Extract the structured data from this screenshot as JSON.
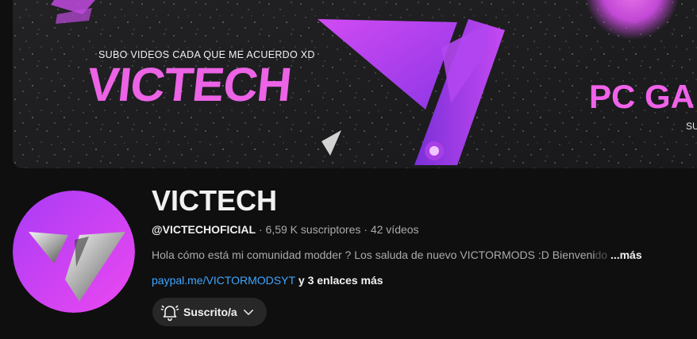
{
  "banner": {
    "tagline": "SUBO VIDEOS CADA QUE ME ACUERDO XD",
    "logo_text": "VICTECH",
    "right_text": "PC GA",
    "right_subtext": "SU"
  },
  "channel": {
    "name": "VICTECH",
    "handle": "@VICTECHOFICIAL",
    "separator": " · ",
    "subscribers": "6,59 K suscriptores",
    "videos": "42 vídeos",
    "description": "Hola cómo está mi comunidad modder ? Los saluda de nuevo VICTORMODS :D Bienveni",
    "description_fade": "do",
    "description_more": "...más",
    "link": "paypal.me/VICTORMODSYT",
    "more_links": " y 3 enlaces más"
  },
  "subscribe_button": {
    "label": "Suscrito/a",
    "bell_icon": "bell-icon",
    "chevron_icon": "chevron-down-icon"
  },
  "colors": {
    "background": "#0f0f0f",
    "accent_pink": "#ec63e6",
    "link_blue": "#3ea6ff",
    "button_bg": "#272727"
  }
}
